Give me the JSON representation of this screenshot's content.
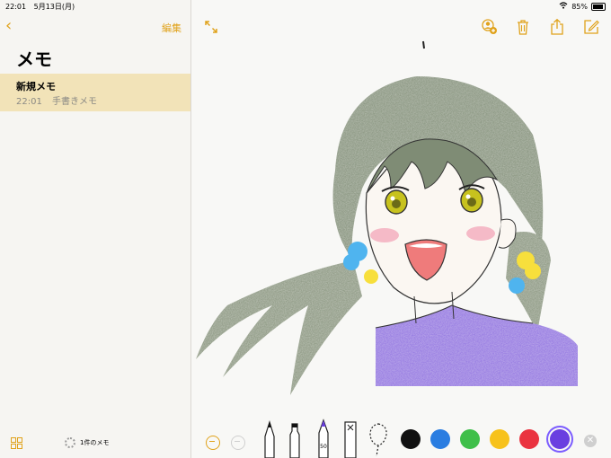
{
  "status_bar": {
    "time": "22:01",
    "date": "5月13日(月)",
    "battery": "85%"
  },
  "sidebar": {
    "back_icon": "chevron-left-icon",
    "edit_label": "編集",
    "title": "メモ",
    "notes": [
      {
        "title": "新規メモ",
        "time": "22:01",
        "preview": "手書きメモ"
      }
    ],
    "footer_count": "1件のメモ"
  },
  "canvas": {
    "toolbar_icons": [
      "add-person-icon",
      "trash-icon",
      "share-icon",
      "compose-icon"
    ],
    "tools": [
      "pen",
      "marker",
      "pencil",
      "eraser",
      "lasso"
    ],
    "colors": [
      "#111111",
      "#2a7de1",
      "#3fbf4a",
      "#f7c21c",
      "#ea3340",
      "#6a3fe0"
    ],
    "selected_color_index": 5
  },
  "accent_color": "#e0a21b"
}
